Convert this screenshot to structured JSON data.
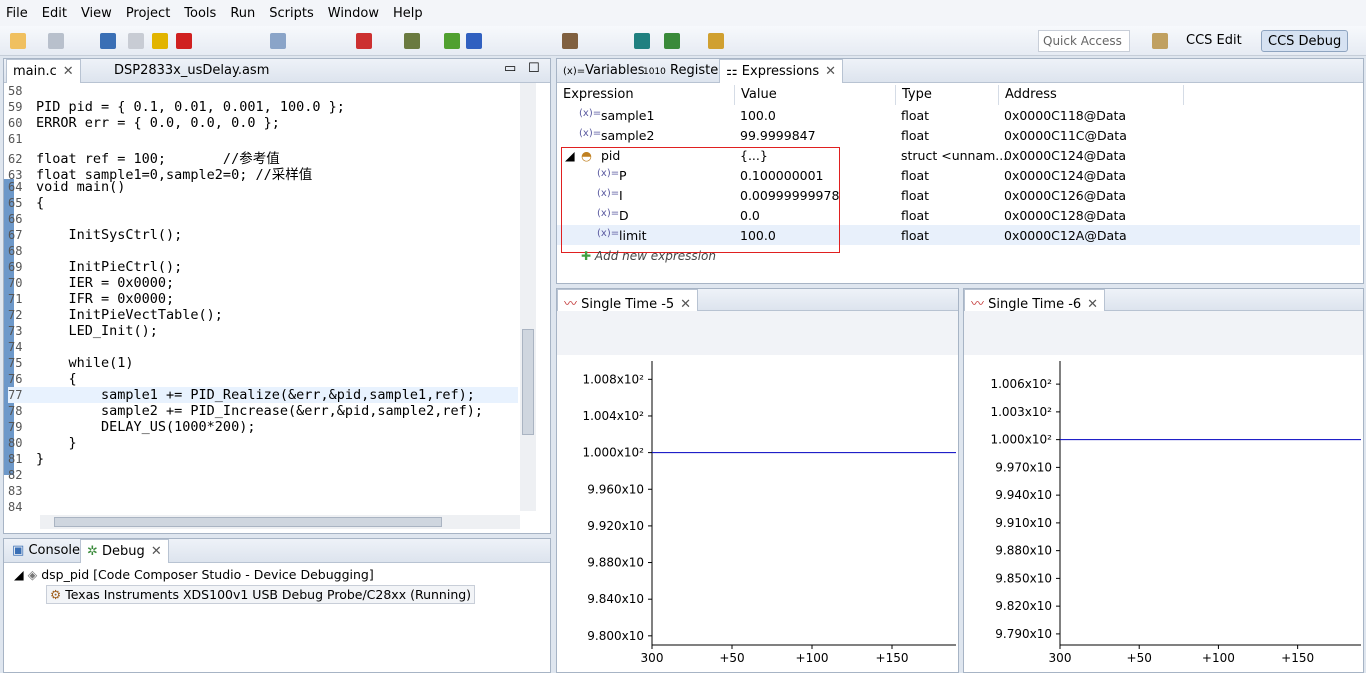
{
  "menu": [
    "File",
    "Edit",
    "View",
    "Project",
    "Tools",
    "Run",
    "Scripts",
    "Window",
    "Help"
  ],
  "quick_access": "Quick Access",
  "perspectives": [
    "CCS Edit",
    "CCS Debug"
  ],
  "editor": {
    "tabs": [
      "main.c",
      "DSP2833x_usDelay.asm"
    ],
    "lines": [
      {
        "n": "58",
        "t": ""
      },
      {
        "n": "59",
        "t": "PID pid = { 0.1, 0.01, 0.001, 100.0 };"
      },
      {
        "n": "60",
        "t": "ERROR err = { 0.0, 0.0, 0.0 };"
      },
      {
        "n": "61",
        "t": ""
      },
      {
        "n": "62",
        "t": "float ref = 100;       //参考值"
      },
      {
        "n": "63",
        "t": "float sample1=0,sample2=0; //采样值"
      },
      {
        "n": "64",
        "t": "void main()"
      },
      {
        "n": "65",
        "t": "{"
      },
      {
        "n": "66",
        "t": ""
      },
      {
        "n": "67",
        "t": "    InitSysCtrl();"
      },
      {
        "n": "68",
        "t": ""
      },
      {
        "n": "69",
        "t": "    InitPieCtrl();"
      },
      {
        "n": "70",
        "t": "    IER = 0x0000;"
      },
      {
        "n": "71",
        "t": "    IFR = 0x0000;"
      },
      {
        "n": "72",
        "t": "    InitPieVectTable();"
      },
      {
        "n": "73",
        "t": "    LED_Init();"
      },
      {
        "n": "74",
        "t": ""
      },
      {
        "n": "75",
        "t": "    while(1)"
      },
      {
        "n": "76",
        "t": "    {"
      },
      {
        "n": "77",
        "t": "        sample1 += PID_Realize(&err,&pid,sample1,ref);"
      },
      {
        "n": "78",
        "t": "        sample2 += PID_Increase(&err,&pid,sample2,ref);"
      },
      {
        "n": "79",
        "t": "        DELAY_US(1000*200);"
      },
      {
        "n": "80",
        "t": "    }"
      },
      {
        "n": "81",
        "t": "}"
      },
      {
        "n": "82",
        "t": ""
      },
      {
        "n": "83",
        "t": ""
      },
      {
        "n": "84",
        "t": ""
      }
    ]
  },
  "views": {
    "tabs": [
      "Variables",
      "Registers",
      "Expressions"
    ],
    "columns": [
      "Expression",
      "Value",
      "Type",
      "Address"
    ],
    "rows": [
      {
        "expr": "sample1",
        "value": "100.0",
        "type": "float",
        "addr": "0x0000C118@Data"
      },
      {
        "expr": "sample2",
        "value": "99.9999847",
        "type": "float",
        "addr": "0x0000C11C@Data"
      },
      {
        "expr": "pid",
        "value": "{...}",
        "type": "struct <unnam...",
        "addr": "0x0000C124@Data"
      },
      {
        "expr": "P",
        "value": "0.100000001",
        "type": "float",
        "addr": "0x0000C124@Data"
      },
      {
        "expr": "I",
        "value": "0.00999999978",
        "type": "float",
        "addr": "0x0000C126@Data"
      },
      {
        "expr": "D",
        "value": "0.0",
        "type": "float",
        "addr": "0x0000C128@Data"
      },
      {
        "expr": "limit",
        "value": "100.0",
        "type": "float",
        "addr": "0x0000C12A@Data"
      }
    ],
    "add_new": "Add new expression"
  },
  "debug": {
    "tabs": [
      "Console",
      "Debug"
    ],
    "session": "dsp_pid [Code Composer Studio - Device Debugging]",
    "probe": "Texas Instruments XDS100v1 USB Debug Probe/C28xx (Running)"
  },
  "chart_data": [
    {
      "type": "line",
      "title": "Single Time -5",
      "yticks": [
        "1.008x10²",
        "1.004x10²",
        "1.000x10²",
        "9.960x10",
        "9.920x10",
        "9.880x10",
        "9.840x10",
        "9.800x10"
      ],
      "ytick_values": [
        100.8,
        100.4,
        100.0,
        99.6,
        99.2,
        98.8,
        98.4,
        98.0
      ],
      "xticks": [
        "300",
        "+50",
        "+100",
        "+150"
      ],
      "ylim": [
        97.9,
        101.0
      ],
      "series": [
        {
          "x": [
            300,
            490
          ],
          "y": [
            100.0,
            100.0
          ]
        }
      ],
      "color": "#0000c0"
    },
    {
      "type": "line",
      "title": "Single Time -6",
      "yticks": [
        "1.006x10²",
        "1.003x10²",
        "1.000x10²",
        "9.970x10",
        "9.940x10",
        "9.910x10",
        "9.880x10",
        "9.850x10",
        "9.820x10",
        "9.790x10"
      ],
      "ytick_values": [
        100.6,
        100.3,
        100.0,
        99.7,
        99.4,
        99.1,
        98.8,
        98.5,
        98.2,
        97.9
      ],
      "xticks": [
        "300",
        "+50",
        "+100",
        "+150"
      ],
      "ylim": [
        97.78,
        100.85
      ],
      "series": [
        {
          "x": [
            300,
            490
          ],
          "y": [
            100.0,
            100.0
          ]
        }
      ],
      "color": "#0000c0"
    }
  ]
}
